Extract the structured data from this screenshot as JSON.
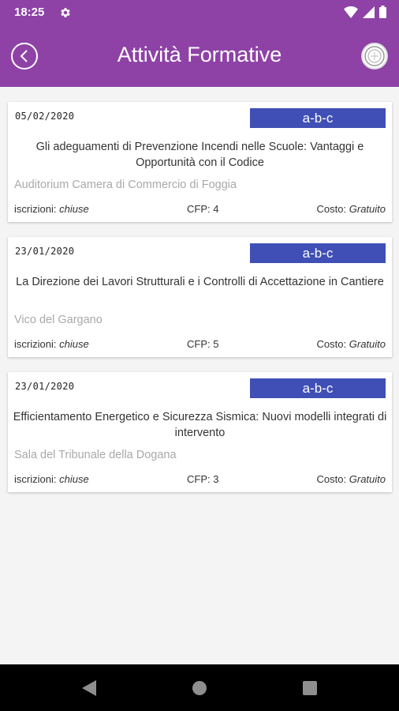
{
  "status_bar": {
    "time": "18:25"
  },
  "app_bar": {
    "title": "Attività Formative"
  },
  "labels": {
    "iscrizioni": "iscrizioni:",
    "cfp": "CFP:",
    "costo": "Costo:"
  },
  "events": [
    {
      "date": "05/02/2020",
      "badge": "a-b-c",
      "title": "Gli adeguamenti di Prevenzione Incendi nelle Scuole: Vantaggi e Opportunità con il Codice",
      "location": "Auditorium Camera di Commercio di Foggia",
      "iscrizioni": "chiuse",
      "cfp": "4",
      "costo": "Gratuito"
    },
    {
      "date": "23/01/2020",
      "badge": "a-b-c",
      "title": "La Direzione dei Lavori Strutturali e i Controlli di Accettazione in Cantiere",
      "location": "Vico del Gargano",
      "iscrizioni": "chiuse",
      "cfp": "5",
      "costo": "Gratuito"
    },
    {
      "date": "23/01/2020",
      "badge": "a-b-c",
      "title": "Efficientamento Energetico e Sicurezza Sismica: Nuovi modelli integrati di intervento",
      "location": "Sala del Tribunale della Dogana",
      "iscrizioni": "chiuse",
      "cfp": "3",
      "costo": "Gratuito"
    }
  ],
  "colors": {
    "primary": "#8e42a6",
    "badge": "#3f4fb5",
    "location": "#a9a9a9",
    "background": "#f4f4f4"
  },
  "icons": [
    "settings-icon",
    "wifi-icon",
    "signal-icon",
    "battery-icon",
    "back-arrow-icon",
    "logo-icon",
    "nav-back-icon",
    "nav-home-icon",
    "nav-recent-icon"
  ]
}
